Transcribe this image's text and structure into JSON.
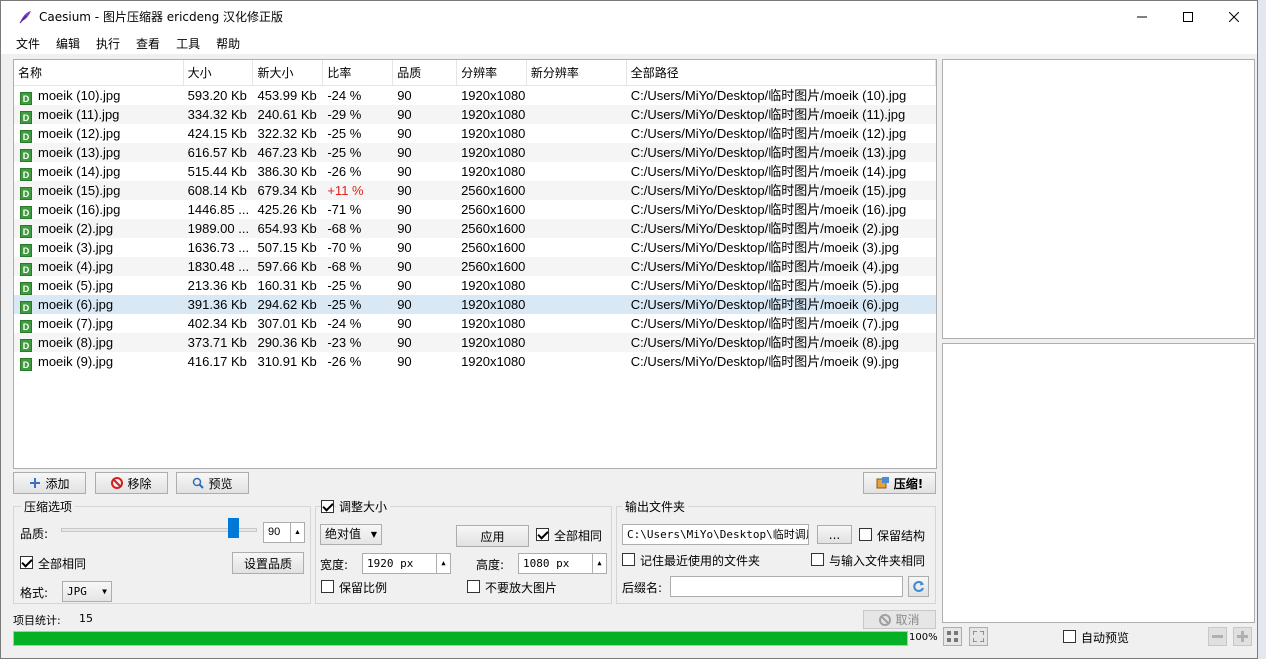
{
  "window": {
    "title": "Caesium - 图片压缩器  ericdeng 汉化修正版",
    "icons": {
      "app": "feather-icon",
      "minimize": "minimize-icon",
      "maximize": "maximize-icon",
      "close": "close-icon"
    }
  },
  "menu": [
    "文件",
    "编辑",
    "执行",
    "查看",
    "工具",
    "帮助"
  ],
  "table": {
    "columns": [
      "名称",
      "大小",
      "新大小",
      "比率",
      "品质",
      "分辨率",
      "新分辨率",
      "全部路径"
    ],
    "rows": [
      {
        "name": "moeik (10).jpg",
        "size": "593.20 Kb",
        "new_size": "453.99 Kb",
        "ratio": "-24 %",
        "quality": "90",
        "resolution": "1920x1080",
        "new_resolution": "",
        "path": "C:/Users/MiYo/Desktop/临时图片/moeik (10).jpg"
      },
      {
        "name": "moeik (11).jpg",
        "size": "334.32 Kb",
        "new_size": "240.61 Kb",
        "ratio": "-29 %",
        "quality": "90",
        "resolution": "1920x1080",
        "new_resolution": "",
        "path": "C:/Users/MiYo/Desktop/临时图片/moeik (11).jpg"
      },
      {
        "name": "moeik (12).jpg",
        "size": "424.15 Kb",
        "new_size": "322.32 Kb",
        "ratio": "-25 %",
        "quality": "90",
        "resolution": "1920x1080",
        "new_resolution": "",
        "path": "C:/Users/MiYo/Desktop/临时图片/moeik (12).jpg"
      },
      {
        "name": "moeik (13).jpg",
        "size": "616.57 Kb",
        "new_size": "467.23 Kb",
        "ratio": "-25 %",
        "quality": "90",
        "resolution": "1920x1080",
        "new_resolution": "",
        "path": "C:/Users/MiYo/Desktop/临时图片/moeik (13).jpg"
      },
      {
        "name": "moeik (14).jpg",
        "size": "515.44 Kb",
        "new_size": "386.30 Kb",
        "ratio": "-26 %",
        "quality": "90",
        "resolution": "1920x1080",
        "new_resolution": "",
        "path": "C:/Users/MiYo/Desktop/临时图片/moeik (14).jpg"
      },
      {
        "name": "moeik (15).jpg",
        "size": "608.14 Kb",
        "new_size": "679.34 Kb",
        "ratio": "+11 %",
        "quality": "90",
        "resolution": "2560x1600",
        "new_resolution": "",
        "path": "C:/Users/MiYo/Desktop/临时图片/moeik (15).jpg"
      },
      {
        "name": "moeik (16).jpg",
        "size": "1446.85 ...",
        "new_size": "425.26 Kb",
        "ratio": "-71 %",
        "quality": "90",
        "resolution": "2560x1600",
        "new_resolution": "",
        "path": "C:/Users/MiYo/Desktop/临时图片/moeik (16).jpg"
      },
      {
        "name": "moeik (2).jpg",
        "size": "1989.00 ...",
        "new_size": "654.93 Kb",
        "ratio": "-68 %",
        "quality": "90",
        "resolution": "2560x1600",
        "new_resolution": "",
        "path": "C:/Users/MiYo/Desktop/临时图片/moeik (2).jpg"
      },
      {
        "name": "moeik (3).jpg",
        "size": "1636.73 ...",
        "new_size": "507.15 Kb",
        "ratio": "-70 %",
        "quality": "90",
        "resolution": "2560x1600",
        "new_resolution": "",
        "path": "C:/Users/MiYo/Desktop/临时图片/moeik (3).jpg"
      },
      {
        "name": "moeik (4).jpg",
        "size": "1830.48 ...",
        "new_size": "597.66 Kb",
        "ratio": "-68 %",
        "quality": "90",
        "resolution": "2560x1600",
        "new_resolution": "",
        "path": "C:/Users/MiYo/Desktop/临时图片/moeik (4).jpg"
      },
      {
        "name": "moeik (5).jpg",
        "size": "213.36 Kb",
        "new_size": "160.31 Kb",
        "ratio": "-25 %",
        "quality": "90",
        "resolution": "1920x1080",
        "new_resolution": "",
        "path": "C:/Users/MiYo/Desktop/临时图片/moeik (5).jpg"
      },
      {
        "name": "moeik (6).jpg",
        "size": "391.36 Kb",
        "new_size": "294.62 Kb",
        "ratio": "-25 %",
        "quality": "90",
        "resolution": "1920x1080",
        "new_resolution": "",
        "path": "C:/Users/MiYo/Desktop/临时图片/moeik (6).jpg"
      },
      {
        "name": "moeik (7).jpg",
        "size": "402.34 Kb",
        "new_size": "307.01 Kb",
        "ratio": "-24 %",
        "quality": "90",
        "resolution": "1920x1080",
        "new_resolution": "",
        "path": "C:/Users/MiYo/Desktop/临时图片/moeik (7).jpg"
      },
      {
        "name": "moeik (8).jpg",
        "size": "373.71 Kb",
        "new_size": "290.36 Kb",
        "ratio": "-23 %",
        "quality": "90",
        "resolution": "1920x1080",
        "new_resolution": "",
        "path": "C:/Users/MiYo/Desktop/临时图片/moeik (8).jpg"
      },
      {
        "name": "moeik (9).jpg",
        "size": "416.17 Kb",
        "new_size": "310.91 Kb",
        "ratio": "-26 %",
        "quality": "90",
        "resolution": "1920x1080",
        "new_resolution": "",
        "path": "C:/Users/MiYo/Desktop/临时图片/moeik (9).jpg"
      }
    ],
    "selected_row": 11,
    "file_icon_letter": "D"
  },
  "toolbar": {
    "add": "添加",
    "remove": "移除",
    "preview": "预览",
    "compress": "压缩!",
    "icons": {
      "add": "plus-icon",
      "remove": "forbidden-icon",
      "preview": "magnifier-icon",
      "compress": "compress-icon"
    }
  },
  "compression": {
    "group_label": "压缩选项",
    "quality_label": "品质:",
    "quality_value": "90",
    "quality_level": 90,
    "same_all_label": "全部相同",
    "same_all_checked": true,
    "set_quality": "设置品质",
    "format_label": "格式:",
    "format_value": "JPG"
  },
  "resize": {
    "group_label": "调整大小",
    "enabled": true,
    "mode": "绝对值",
    "apply": "应用",
    "same_all_label": "全部相同",
    "same_all_checked": true,
    "width_label": "宽度:",
    "width_value": "1920 px",
    "height_label": "高度:",
    "height_value": "1080 px",
    "keep_ratio_label": "保留比例",
    "keep_ratio_checked": false,
    "no_enlarge_label": "不要放大图片",
    "no_enlarge_checked": false
  },
  "output": {
    "group_label": "输出文件夹",
    "path": "C:\\Users\\MiYo\\Desktop\\临时调用",
    "browse": "...",
    "keep_structure_label": "保留结构",
    "keep_structure_checked": false,
    "remember_label": "记住最近使用的文件夹",
    "remember_checked": false,
    "same_as_input_label": "与输入文件夹相同",
    "same_as_input_checked": false,
    "suffix_label": "后缀名:",
    "suffix_value": ""
  },
  "status": {
    "count_label": "项目统计:",
    "count_value": "15",
    "cancel": "取消",
    "progress_text": "100%",
    "progress_level": 100
  },
  "preview_panel": {
    "auto_preview_label": "自动预览",
    "auto_preview_checked": false
  }
}
